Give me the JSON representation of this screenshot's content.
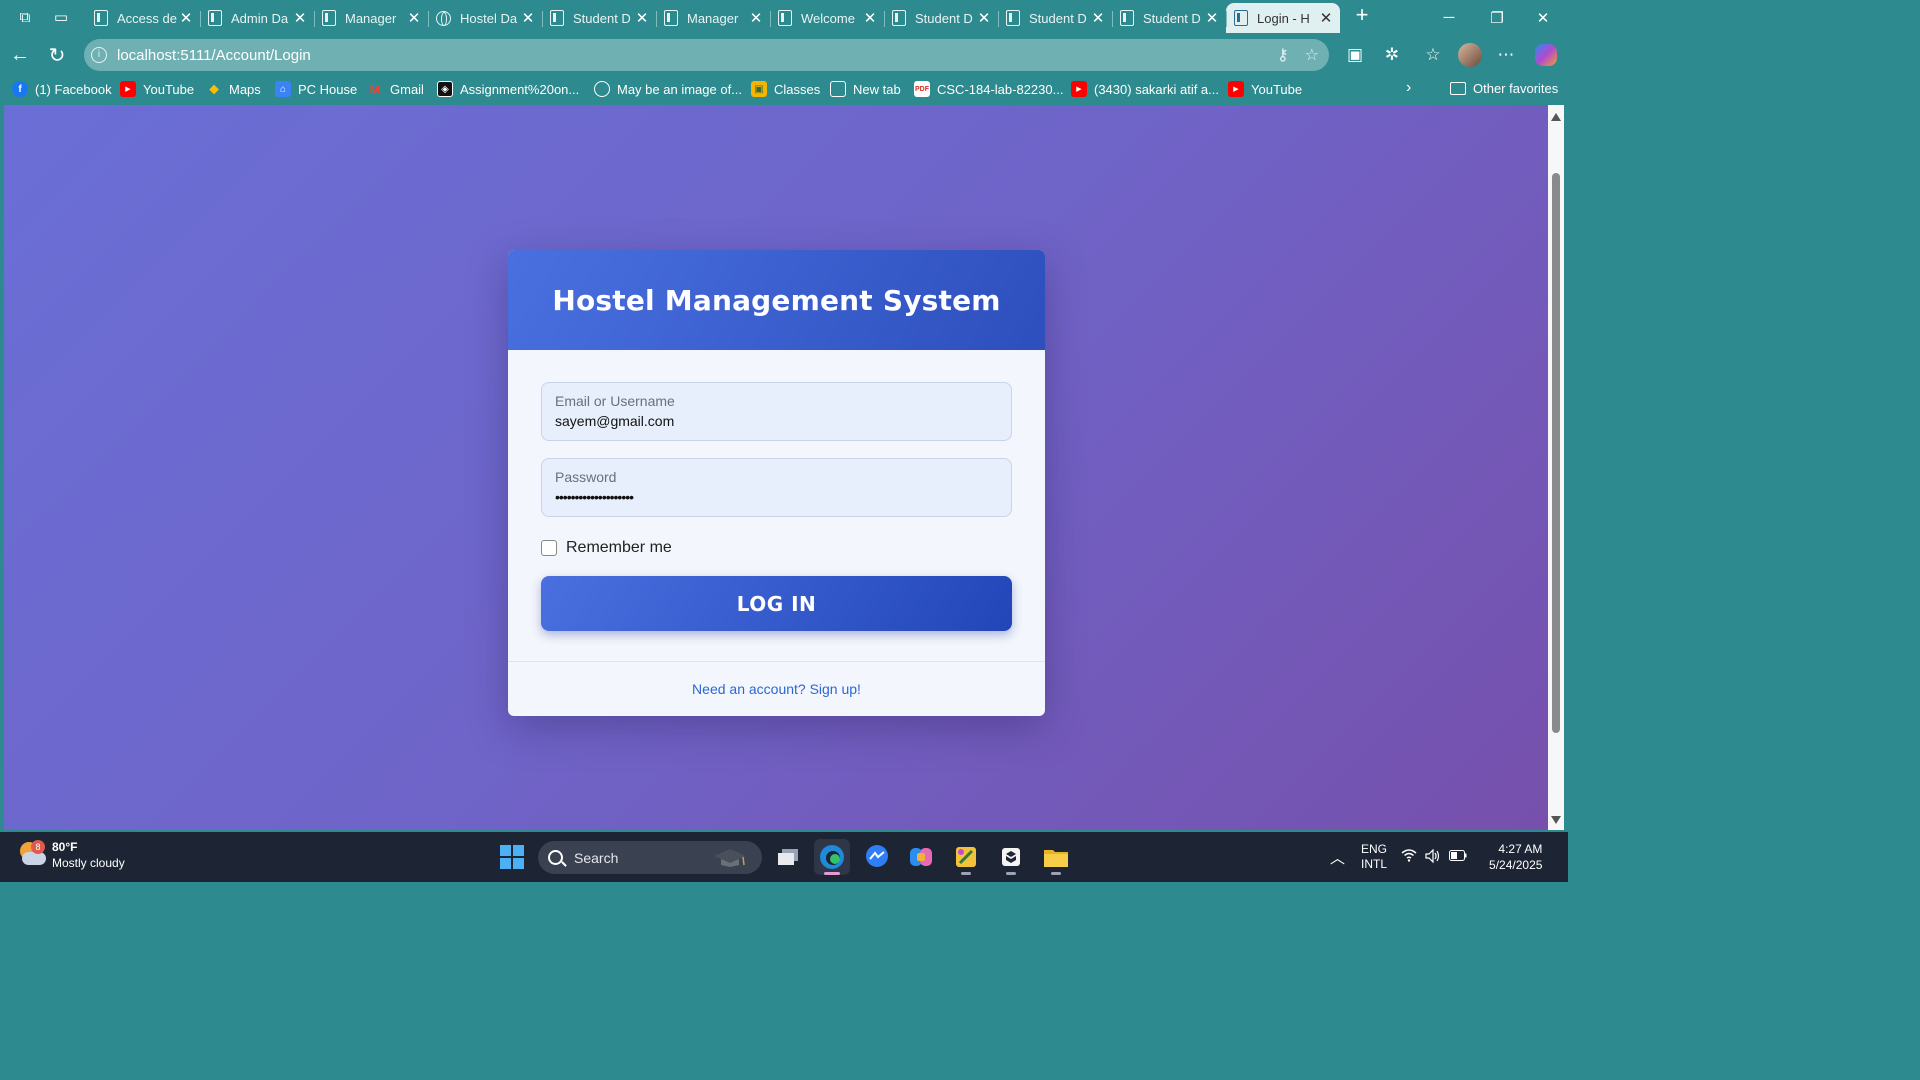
{
  "browser": {
    "tabs": [
      {
        "title": "Access de",
        "icon": "page-icon",
        "active": false
      },
      {
        "title": "Admin Da",
        "icon": "page-icon",
        "active": false
      },
      {
        "title": "Manager",
        "icon": "page-icon",
        "active": false
      },
      {
        "title": "Hostel Da",
        "icon": "globe-icon",
        "active": false
      },
      {
        "title": "Student D",
        "icon": "page-icon",
        "active": false
      },
      {
        "title": "Manager",
        "icon": "page-icon",
        "active": false
      },
      {
        "title": "Welcome",
        "icon": "page-icon",
        "active": false
      },
      {
        "title": "Student D",
        "icon": "page-icon",
        "active": false
      },
      {
        "title": "Student D",
        "icon": "page-icon",
        "active": false
      },
      {
        "title": "Student D",
        "icon": "page-icon",
        "active": false
      },
      {
        "title": "Login - H",
        "icon": "page-icon",
        "active": true
      }
    ],
    "url": "localhost:5111/Account/Login",
    "favorites": [
      {
        "label": "(1) Facebook",
        "icon": "facebook-icon",
        "color": "#1877f2",
        "glyph": "f"
      },
      {
        "label": "YouTube",
        "icon": "youtube-icon",
        "color": "#ff0000",
        "glyph": "▶"
      },
      {
        "label": "Maps",
        "icon": "maps-icon",
        "color": "#34a853",
        "glyph": "◆"
      },
      {
        "label": "PC House",
        "icon": "pc-house-icon",
        "color": "#3b82f6",
        "glyph": "⌂"
      },
      {
        "label": "Gmail",
        "icon": "gmail-icon",
        "color": "#ea4335",
        "glyph": "M"
      },
      {
        "label": "Assignment%20on...",
        "icon": "assignment-icon",
        "color": "#111111",
        "glyph": "◈"
      },
      {
        "label": "May be an image of...",
        "icon": "globe-icon",
        "color": "#2d8a8f",
        "glyph": "◎"
      },
      {
        "label": "Classes",
        "icon": "classes-icon",
        "color": "#f4b400",
        "glyph": "▣"
      },
      {
        "label": "New tab",
        "icon": "new-tab-icon",
        "color": "#2d8a8f",
        "glyph": "▢"
      },
      {
        "label": "CSC-184-lab-82230...",
        "icon": "pdf-icon",
        "color": "#d93025",
        "glyph": "P"
      },
      {
        "label": "(3430) sakarki atif a...",
        "icon": "youtube-icon",
        "color": "#ff0000",
        "glyph": "▶"
      },
      {
        "label": "YouTube",
        "icon": "youtube-icon",
        "color": "#ff0000",
        "glyph": "▶"
      }
    ],
    "other_favorites": "Other favorites"
  },
  "login": {
    "title": "Hostel Management System",
    "email_label": "Email or Username",
    "email_value": "sayem@gmail.com",
    "password_label": "Password",
    "password_value": "••••••••••••••••••••",
    "remember_label": "Remember me",
    "remember_checked": false,
    "login_button": "LOG IN",
    "signup_link": "Need an account? Sign up!"
  },
  "colors": {
    "accent": "#2d8a8f",
    "header_blue": "#3b5fd4",
    "background_start": "#6a6fd6",
    "background_end": "#7650ac",
    "link": "#2a67d6"
  },
  "taskbar": {
    "weather_badge": "8",
    "temperature": "80°F",
    "condition": "Mostly cloudy",
    "search_label": "Search",
    "language_top": "ENG",
    "language_bottom": "INTL",
    "time": "4:27 AM",
    "date": "5/24/2025"
  }
}
